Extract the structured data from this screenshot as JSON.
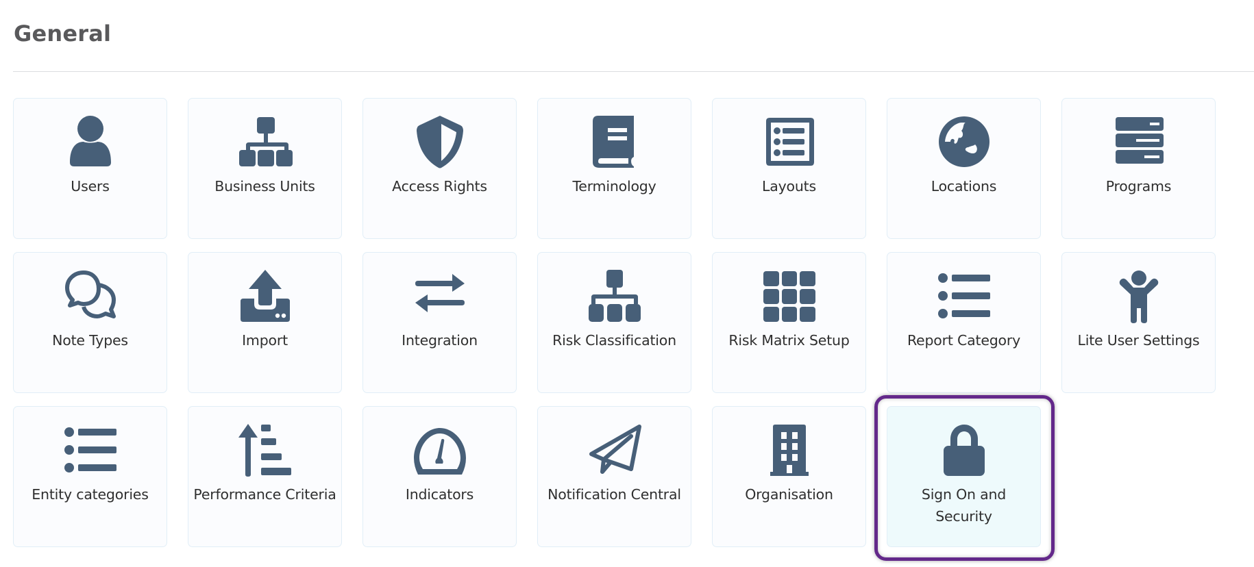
{
  "section": {
    "title": "General"
  },
  "theme": {
    "icon_color": "#475f78",
    "highlight_color": "#63288a",
    "selected_bg": "#eefafc"
  },
  "tiles": [
    {
      "label": "Users",
      "icon": "user-icon"
    },
    {
      "label": "Business Units",
      "icon": "sitemap-icon"
    },
    {
      "label": "Access Rights",
      "icon": "shield-icon"
    },
    {
      "label": "Terminology",
      "icon": "book-icon"
    },
    {
      "label": "Layouts",
      "icon": "list-alt-icon"
    },
    {
      "label": "Locations",
      "icon": "globe-icon"
    },
    {
      "label": "Programs",
      "icon": "server-icon"
    },
    {
      "label": "Note Types",
      "icon": "comments-icon"
    },
    {
      "label": "Import",
      "icon": "upload-icon"
    },
    {
      "label": "Integration",
      "icon": "exchange-icon"
    },
    {
      "label": "Risk Classification",
      "icon": "sitemap-icon"
    },
    {
      "label": "Risk Matrix Setup",
      "icon": "grid-icon"
    },
    {
      "label": "Report Category",
      "icon": "list-ul-icon"
    },
    {
      "label": "Lite User Settings",
      "icon": "child-icon"
    },
    {
      "label": "Entity categories",
      "icon": "list-ul-icon"
    },
    {
      "label": "Performance Criteria",
      "icon": "sort-amount-up-icon"
    },
    {
      "label": "Indicators",
      "icon": "tachometer-icon"
    },
    {
      "label": "Notification Central",
      "icon": "paper-plane-icon"
    },
    {
      "label": "Organisation",
      "icon": "building-icon"
    },
    {
      "label": "Sign On and Security",
      "icon": "lock-icon",
      "selected": true
    }
  ]
}
